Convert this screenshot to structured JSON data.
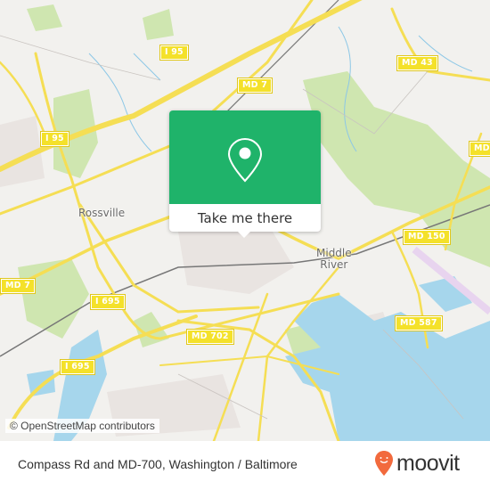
{
  "map": {
    "road_shields": [
      {
        "label": "I 95"
      },
      {
        "label": "I 95"
      },
      {
        "label": "MD 7"
      },
      {
        "label": "MD 43"
      },
      {
        "label": "MD"
      },
      {
        "label": "MD 7"
      },
      {
        "label": "I 695"
      },
      {
        "label": "I 695"
      },
      {
        "label": "MD 702"
      },
      {
        "label": "MD 150"
      },
      {
        "label": "MD 587"
      }
    ],
    "places": [
      {
        "label": "Rossville"
      },
      {
        "label": "Middle\nRiver"
      }
    ],
    "attribution": "© OpenStreetMap contributors"
  },
  "card": {
    "icon": "map-pin-icon",
    "button_label": "Take me there",
    "color": "#1fb36a"
  },
  "footer": {
    "title": "Compass Rd and MD-700, Washington / Baltimore",
    "brand": "moovit",
    "brand_color": "#f26a3d"
  }
}
